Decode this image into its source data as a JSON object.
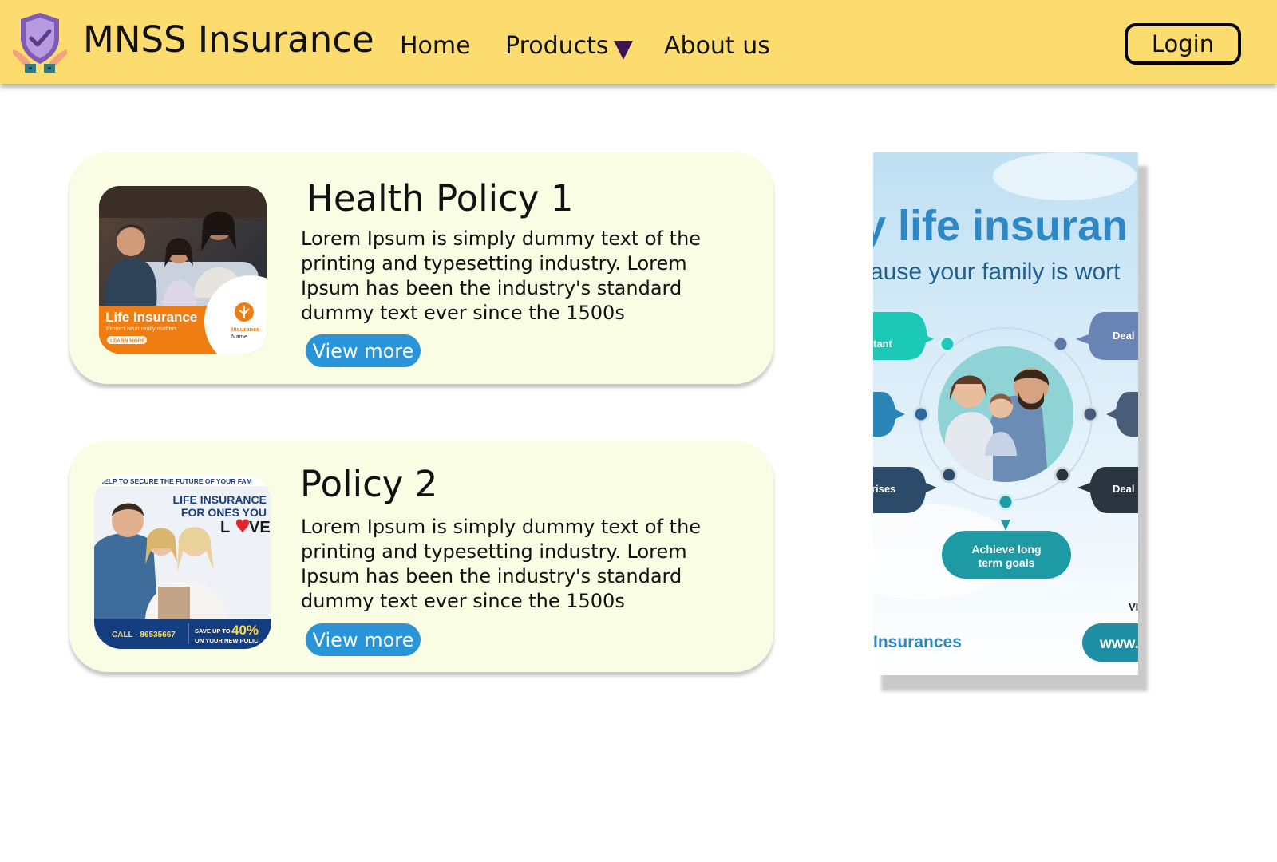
{
  "header": {
    "brand": "MNSS Insurance",
    "nav": [
      {
        "label": "Home"
      },
      {
        "label": "Products"
      },
      {
        "label": "About us"
      }
    ],
    "login_label": "Login",
    "logo_icon": "shield-check-hands-icon",
    "dropdown_icon": "caret-down-icon"
  },
  "policies": [
    {
      "title": "Health Policy 1",
      "description": "Lorem Ipsum is simply dummy text of the printing and typesetting industry. Lorem Ipsum has been the industry's standard dummy text ever since the 1500s",
      "button": "View more",
      "image": {
        "banner_title": "Life Insurance",
        "tagline": "Protect what really matters",
        "cta": "LEARN MORE",
        "logo_text_1": "Insurance",
        "logo_text_2": "Name"
      }
    },
    {
      "title": "Policy 2",
      "description": "Lorem Ipsum is simply dummy text of the printing and typesetting industry. Lorem Ipsum has been the industry's standard dummy text ever since the 1500s",
      "button": "View more",
      "image": {
        "top_text": "HELP TO SECURE THE FUTURE OF YOUR FAM",
        "headline_1": "LIFE INSURANCE",
        "headline_2": "FOR ONES YOU",
        "headline_3_a": "L",
        "headline_3_b": "VE",
        "call": "CALL - 86535667",
        "save_prefix": "SAVE UP TO",
        "save_value": "40%",
        "save_suffix": "ON YOUR NEW POLIC"
      }
    }
  ],
  "ad": {
    "headline": "y life insuran",
    "subline": "ause your family is wort",
    "bubbles": {
      "top_left": "tant",
      "top_right": "Deal",
      "bottom_left": "rises",
      "bottom_right": "Deal",
      "goal_line_1": "Achieve long",
      "goal_line_2": "term goals"
    },
    "side_text": "VI",
    "footer_left": "Insurances",
    "footer_right": "www."
  },
  "colors": {
    "header_bg": "#fddc6f",
    "card_bg": "#f9fde3",
    "button_bg": "#2a94d8",
    "caret": "#3d1456",
    "ad_teal": "#1d9aa3",
    "ad_blue": "#2f87c4"
  }
}
